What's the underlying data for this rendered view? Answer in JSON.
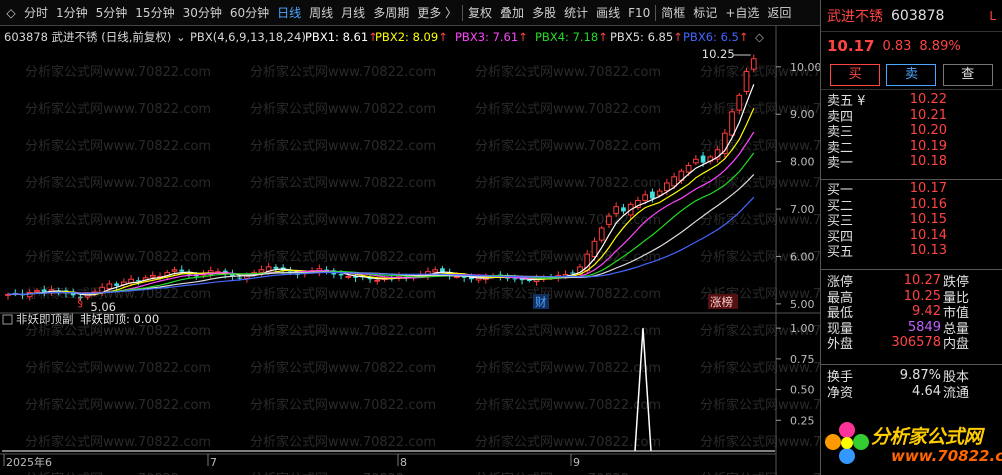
{
  "toolbar": {
    "stock_code_icon": "◇",
    "items": [
      "分时",
      "1分钟",
      "5分钟",
      "15分钟",
      "30分钟",
      "60分钟",
      "日线",
      "周线",
      "月线",
      "多周期",
      "更多 〉",
      "复权",
      "叠加",
      "多股",
      "统计",
      "画线",
      "F10",
      "简框",
      "标记",
      "+自选",
      "返回"
    ],
    "active_index": 6
  },
  "main_legend": {
    "stock_title": "603878 武进不锈 (日线,前复权)",
    "indicator": "PBX(4,6,9,13,18,24)",
    "series": [
      {
        "name": "PBX1",
        "value": "8.61",
        "color": "#ffffff"
      },
      {
        "name": "PBX2",
        "value": "8.09",
        "color": "#ffff00"
      },
      {
        "name": "PBX3",
        "value": "7.61",
        "color": "#ff44ff"
      },
      {
        "name": "PBX4",
        "value": "7.18",
        "color": "#22dd22"
      },
      {
        "name": "PBX5",
        "value": "6.85",
        "color": "#dddddd"
      },
      {
        "name": "PBX6",
        "value": "6.5",
        "color": "#4466ff"
      }
    ],
    "arrow": "↑"
  },
  "sub_legend": {
    "title": "非妖即顶副",
    "label": "非妖即顶: 0.00"
  },
  "watermark": "分析家公式网www.70822.com",
  "chart_data": {
    "type": "candlestick",
    "main_y_ticks": [
      "10.00",
      "9.00",
      "8.00",
      "7.00",
      "6.00",
      "5.00"
    ],
    "main_ylim": [
      4.85,
      10.65
    ],
    "sub_y_ticks": [
      "1.00",
      "0.75",
      "0.50",
      "0.25"
    ],
    "sub_ylim": [
      0,
      1.05
    ],
    "x_labels": [
      "2025年6",
      "7",
      "8",
      "9"
    ],
    "annotations": {
      "high_label": "10.25",
      "low_label": "5.06",
      "low_marker": "§",
      "finance_tag": "财",
      "limit_up_tag": "涨榜"
    },
    "sub_spike": {
      "index": 47,
      "value": 1.0
    }
  },
  "right_panel": {
    "name": "武进不锈",
    "code": "603878",
    "expand_icon": "L",
    "price": "10.17",
    "change": "0.83",
    "pct": "8.89%",
    "buttons": {
      "buy": "买",
      "sell": "卖",
      "query": "查"
    },
    "asks": [
      {
        "label": "卖五 ¥",
        "price": "10.22"
      },
      {
        "label": "卖四",
        "price": "10.21"
      },
      {
        "label": "卖三",
        "price": "10.20"
      },
      {
        "label": "卖二",
        "price": "10.19"
      },
      {
        "label": "卖一",
        "price": "10.18"
      }
    ],
    "bids": [
      {
        "label": "买一",
        "price": "10.17"
      },
      {
        "label": "买二",
        "price": "10.16"
      },
      {
        "label": "买三",
        "price": "10.15"
      },
      {
        "label": "买四",
        "price": "10.14"
      },
      {
        "label": "买五",
        "price": "10.13"
      }
    ],
    "stats1": [
      {
        "label": "涨停",
        "value": "10.27",
        "label2": "跌停",
        "cls": ""
      },
      {
        "label": "最高",
        "value": "10.25",
        "label2": "量比",
        "cls": ""
      },
      {
        "label": "最低",
        "value": "9.42",
        "label2": "市值",
        "cls": ""
      },
      {
        "label": "现量",
        "value": "5849",
        "label2": "总量",
        "cls": "purple"
      },
      {
        "label": "外盘",
        "value": "306578",
        "label2": "内盘",
        "cls": ""
      }
    ],
    "stats2": [
      {
        "label": "换手",
        "value": "9.87%",
        "label2": "股本",
        "cls": "white"
      },
      {
        "label": "净资",
        "value": "4.64",
        "label2": "流通",
        "cls": "white"
      }
    ],
    "logo_text": "分析家公式网",
    "logo_url": "www.70822.com"
  }
}
